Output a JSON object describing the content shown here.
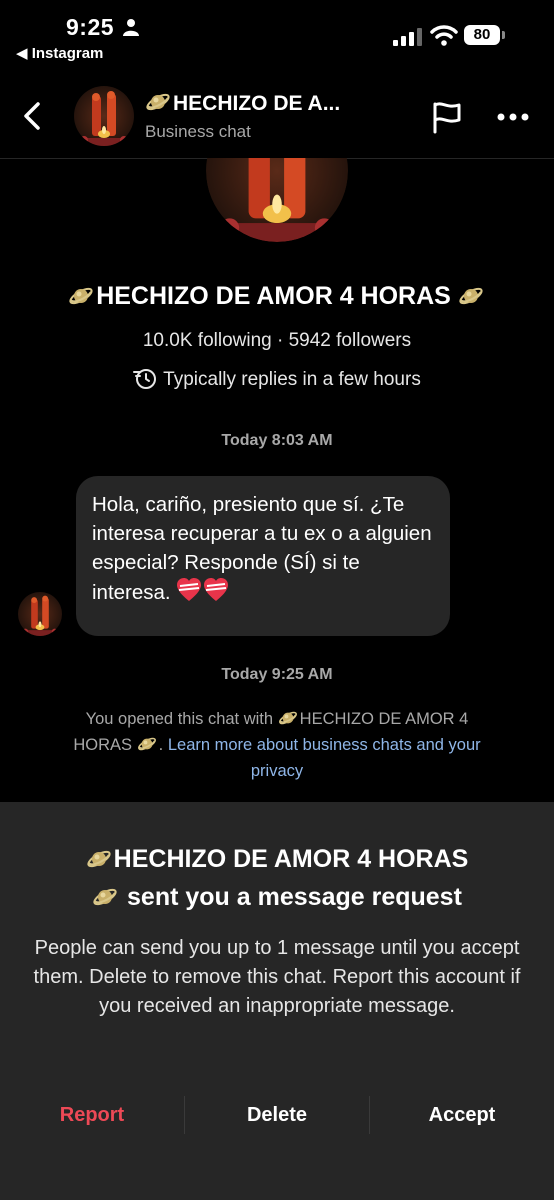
{
  "status_bar": {
    "time": "9:25",
    "back_app": "◀ Instagram",
    "battery": "80"
  },
  "header": {
    "name": "HECHIZO DE A...",
    "subtitle": "Business chat"
  },
  "profile": {
    "name": "HECHIZO DE AMOR 4 HORAS",
    "stats": "10.0K following · 5942 followers",
    "replies": "Typically replies in a few hours"
  },
  "messages": [
    {
      "timestamp": "Today 8:03 AM",
      "text": "Hola, cariño, presiento que sí. ¿Te interesa recuperar a tu ex o a alguien especial? Responde (SÍ) si te interesa."
    }
  ],
  "second_timestamp": "Today 9:25 AM",
  "notice": {
    "prefix": "You opened this chat with",
    "account": "HECHIZO DE AMOR 4 HORAS",
    "suffix": ".",
    "link": "Learn more about business chats and your privacy"
  },
  "request_sheet": {
    "account": "HECHIZO DE AMOR 4 HORAS",
    "title_suffix": "sent you a message request",
    "body": "People can send you up to 1 message until you accept them. Delete to remove this chat. Report this account if you received an inappropriate message.",
    "report_label": "Report",
    "delete_label": "Delete",
    "accept_label": "Accept"
  },
  "colors": {
    "background": "#000000",
    "bubble": "#262626",
    "report": "#ed4956",
    "link": "#8fb6e8"
  }
}
